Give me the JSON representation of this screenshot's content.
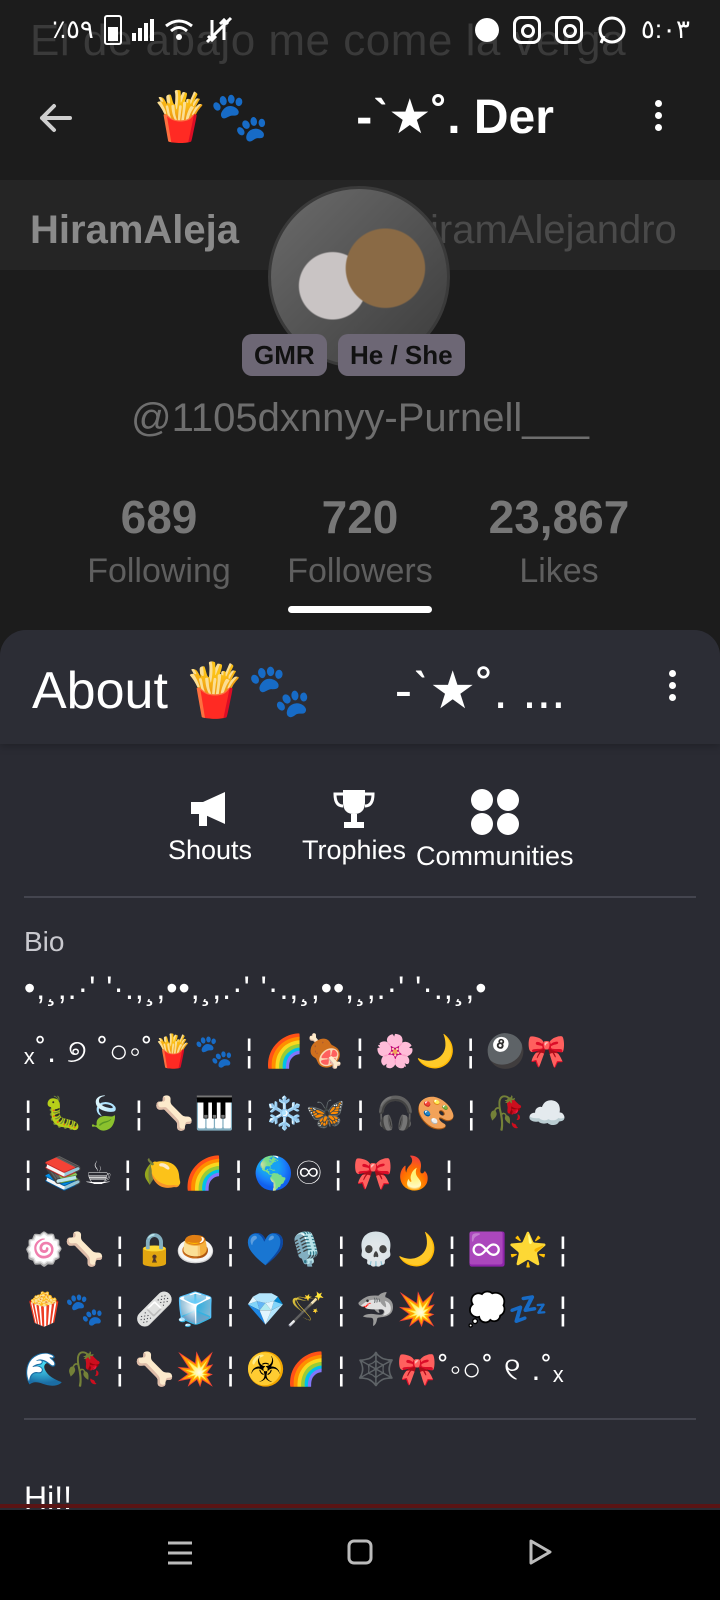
{
  "status_bar": {
    "battery_text": "٪٥٩",
    "time": "٥:٠٣"
  },
  "profile": {
    "banner_text": "El de abajo me come la verga",
    "title": "-ˋ★˚. Der",
    "title_emoji": "🍟🐾",
    "name_left": "HiramAleja",
    "name_right": "iramAlejandro",
    "badges": [
      "GMR",
      "He / She"
    ],
    "handle": "@1105dxnnyy-Purnell___",
    "stats": [
      {
        "value": "689",
        "label": "Following"
      },
      {
        "value": "720",
        "label": "Followers"
      },
      {
        "value": "23,867",
        "label": "Likes"
      }
    ]
  },
  "about": {
    "title": "About 🍟🐾",
    "title_suffix": "-ˋ★˚. ...",
    "actions": [
      {
        "label": "Shouts",
        "icon": "megaphone-icon"
      },
      {
        "label": "Trophies",
        "icon": "trophy-icon"
      },
      {
        "label": "Communities",
        "icon": "communities-icon"
      }
    ],
    "bio_label": "Bio",
    "bio_lines": [
      "•,¸,.·' '·.,¸,••,¸,.·' '·.,¸,••,¸,.·' '·.,¸,•",
      "ₓ˚. ୭ ˚○◦˚🍟🐾 ¦ 🌈🍖 ¦ 🌸🌙 ¦ 🎱🎀",
      "¦ 🐛🍃 ¦ 🦴🎹 ¦ ❄️🦋 ¦ 🎧🎨 ¦ 🥀☁️",
      "¦ 📚☕ ¦ 🍋🌈 ¦ 🌎♾ ¦ 🎀🔥 ¦",
      "🍥🦴 ¦ 🔒🍮 ¦ 💙🎙️ ¦ 💀🌙 ¦ ♾️🌟 ¦",
      "🍿🐾 ¦ 🩹🧊 ¦ 💎🪄 ¦ 🦈💥 ¦ 💭💤 ¦",
      "🌊🥀 ¦ 🦴💥 ¦ ☣️🌈 ¦ 🕸️🎀˚◦○˚ ୧ .˚ₓ"
    ],
    "next_text": "Hi!!"
  }
}
